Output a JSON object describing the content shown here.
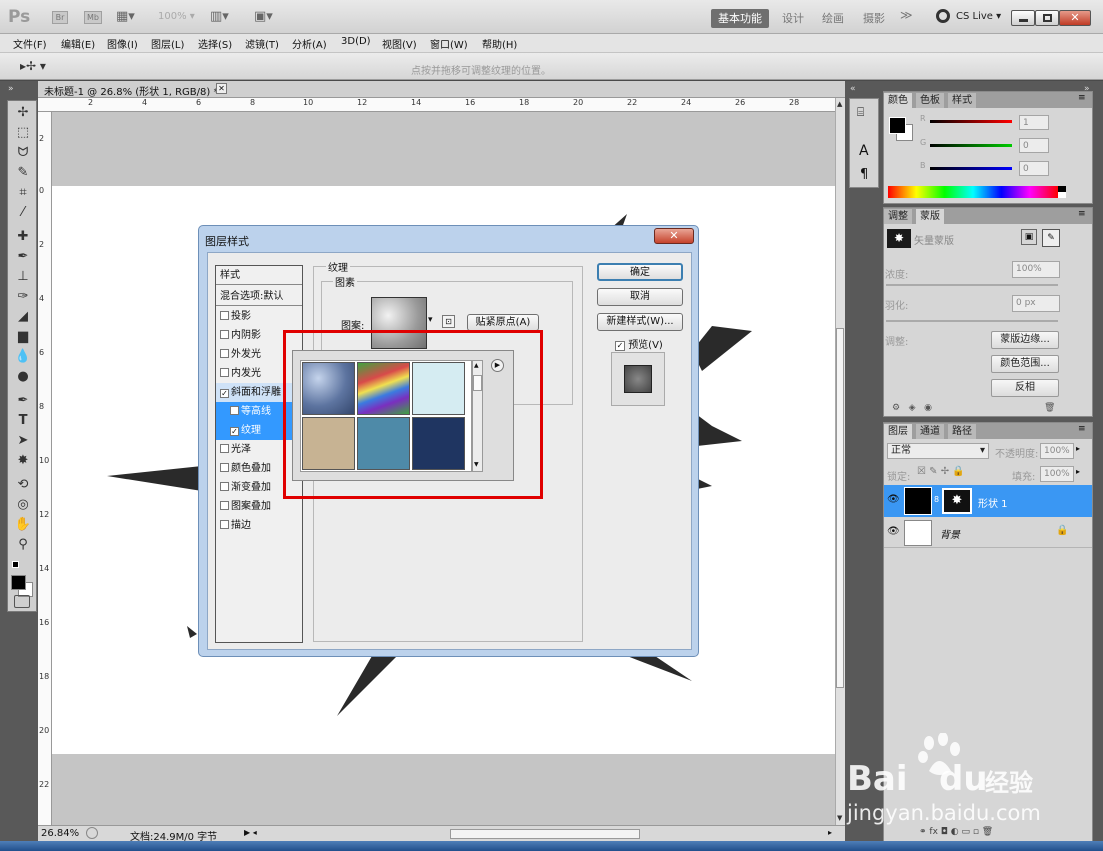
{
  "app": {
    "logo": "Ps",
    "mini_btns": [
      "Br",
      "Mb"
    ],
    "zoom_select": "100%",
    "workspaces": [
      "基本功能",
      "设计",
      "绘画",
      "摄影"
    ],
    "overflow": "≫",
    "cslive": "CS Live"
  },
  "menu": [
    "文件(F)",
    "编辑(E)",
    "图像(I)",
    "图层(L)",
    "选择(S)",
    "滤镜(T)",
    "分析(A)",
    "3D(D)",
    "视图(V)",
    "窗口(W)",
    "帮助(H)"
  ],
  "options": {
    "hint": "点按并拖移可调整纹理的位置。"
  },
  "document": {
    "tab_title": "未标题-1 @ 26.8% (形状 1, RGB/8) *",
    "ruler_top": [
      "2",
      "4",
      "6",
      "8",
      "10",
      "12",
      "14",
      "16",
      "18",
      "20",
      "22",
      "24",
      "26",
      "28"
    ],
    "ruler_left": [
      "2",
      "0",
      "2",
      "4",
      "6",
      "8",
      "10",
      "12",
      "14",
      "16",
      "18",
      "20",
      "22",
      "24"
    ],
    "zoom": "26.84%",
    "doc_info": "文档:24.9M/0 字节",
    "colors": {
      "canvas": "#ffffff",
      "pasteboard": "#c5c5c5",
      "shape": "#2a2a2a"
    }
  },
  "dialog": {
    "title": "图层样式",
    "close": "✕",
    "styles_header": "样式",
    "blend_options": "混合选项:默认",
    "items": [
      {
        "label": "投影",
        "checked": false
      },
      {
        "label": "内阴影",
        "checked": false
      },
      {
        "label": "外发光",
        "checked": false
      },
      {
        "label": "内发光",
        "checked": false
      },
      {
        "label": "斜面和浮雕",
        "checked": true
      },
      {
        "label": "等高线",
        "checked": false
      },
      {
        "label": "纹理",
        "checked": true
      },
      {
        "label": "光泽",
        "checked": false
      },
      {
        "label": "颜色叠加",
        "checked": false
      },
      {
        "label": "渐变叠加",
        "checked": false
      },
      {
        "label": "图案叠加",
        "checked": false
      },
      {
        "label": "描边",
        "checked": false
      }
    ],
    "section_title": "纹理",
    "elements_group": "图素",
    "pattern_label": "图案:",
    "snap_button": "贴紧原点(A)",
    "ok": "确定",
    "cancel": "取消",
    "new_style": "新建样式(W)...",
    "preview_label": "预览(V)",
    "preview_checked": true
  },
  "pattern_picker": {
    "swatches": [
      {
        "name": "bubbles",
        "color": "#6f88b2"
      },
      {
        "name": "rainbow",
        "color": "#7a6fd0"
      },
      {
        "name": "light-blue",
        "color": "#d5ecf2"
      },
      {
        "name": "tan",
        "color": "#c7b393"
      },
      {
        "name": "teal",
        "color": "#4e8aa8"
      },
      {
        "name": "navy",
        "color": "#1f3561"
      }
    ]
  },
  "color_panel": {
    "tabs": [
      "颜色",
      "色板",
      "样式"
    ],
    "channels": [
      {
        "name": "R",
        "value": "1",
        "color": "#cc0000"
      },
      {
        "name": "G",
        "value": "0",
        "color": "#00aa00"
      },
      {
        "name": "B",
        "value": "0",
        "color": "#0000cc"
      }
    ]
  },
  "masks_panel": {
    "tabs": [
      "调整",
      "蒙版"
    ],
    "title": "矢量蒙版",
    "density_label": "浓度:",
    "density_value": "100%",
    "feather_label": "羽化:",
    "feather_value": "0 px",
    "refine_label": "调整:",
    "buttons": [
      "蒙版边缘...",
      "颜色范围...",
      "反相"
    ]
  },
  "layers_panel": {
    "tabs": [
      "图层",
      "通道",
      "路径"
    ],
    "blend_mode": "正常",
    "opacity_label": "不透明度:",
    "opacity": "100%",
    "lock_label": "锁定:",
    "fill_label": "填充:",
    "fill": "100%",
    "layers": [
      {
        "name": "形状 1",
        "selected": true
      },
      {
        "name": "背景",
        "selected": false,
        "locked": true
      }
    ]
  },
  "watermark": {
    "brand": "Bai",
    "brand2": "du",
    "cn": "经验",
    "url": "jingyan.baidu.com"
  }
}
